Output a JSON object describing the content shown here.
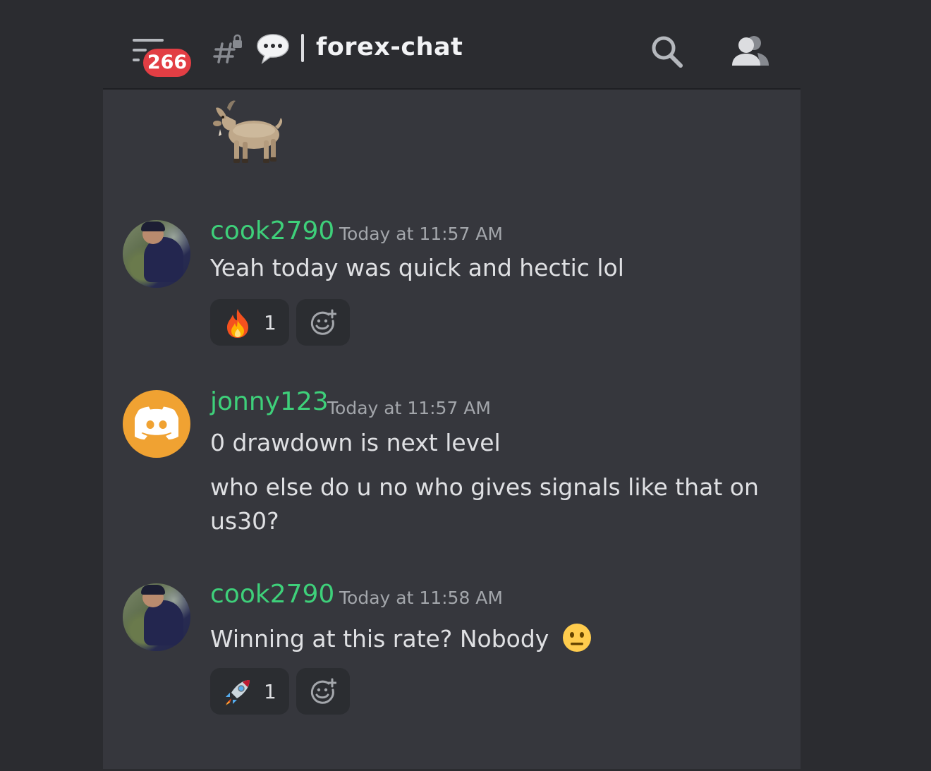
{
  "header": {
    "unread_badge": "266",
    "channel_name": "forex-chat",
    "icons": [
      "menu-icon",
      "locked-channel-hash-icon",
      "thread-icon",
      "search-icon",
      "members-icon"
    ]
  },
  "colors": {
    "username": "#3ed07a",
    "badge": "#e23e44",
    "background": "#2b2c30",
    "panel": "#36373d",
    "reaction_bg": "#2b2d31"
  },
  "messages": [
    {
      "username": "cook2790",
      "timestamp": "Today at 11:57 AM",
      "lines": [
        "Yeah today was quick and hectic lol"
      ],
      "reactions": [
        {
          "emoji": "fire",
          "count": "1"
        }
      ]
    },
    {
      "username": "jonny123",
      "timestamp": "Today at 11:57 AM",
      "lines": [
        "0 drawdown is next level",
        "who else do u no who gives signals like that on",
        "us30?"
      ]
    },
    {
      "username": "cook2790",
      "timestamp": "Today at 11:58 AM",
      "lines": [
        "Winning at this rate? Nobody"
      ],
      "inline_emoji": "neutral-face",
      "reactions": [
        {
          "emoji": "rocket",
          "count": "1"
        }
      ]
    }
  ]
}
